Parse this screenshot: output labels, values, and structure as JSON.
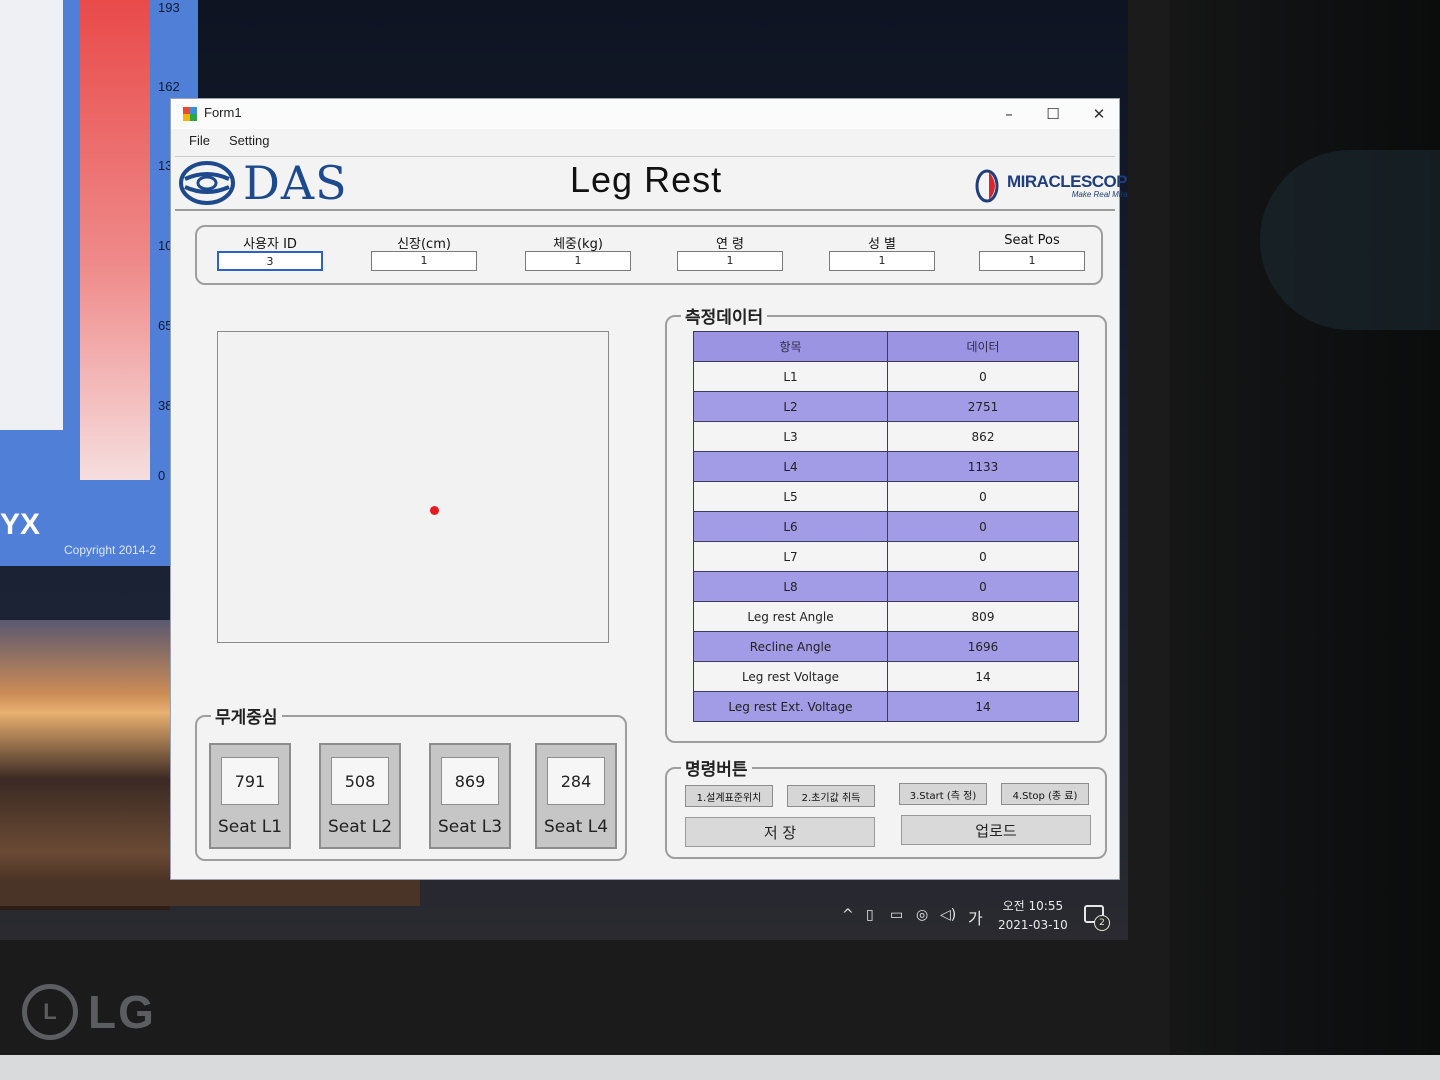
{
  "background_app": {
    "ticks": [
      "193",
      "162",
      "13",
      "10",
      "65",
      "38",
      "0"
    ],
    "brand": "YX",
    "copyright": "Copyright 2014-2"
  },
  "window": {
    "title": "Form1",
    "controls": {
      "minimize": "–",
      "maximize": "☐",
      "close": "✕"
    },
    "menu": [
      "File",
      "Setting"
    ]
  },
  "header": {
    "left_logo": "DAS",
    "title": "Leg Rest",
    "right_logo": "MIRACLESCOPE",
    "right_logo_tagline": "Make Real Miracle"
  },
  "user_info": [
    {
      "label": "사용자 ID",
      "value": "3",
      "active": true
    },
    {
      "label": "신장(cm)",
      "value": "1",
      "active": false
    },
    {
      "label": "체중(kg)",
      "value": "1",
      "active": false
    },
    {
      "label": "연  령",
      "value": "1",
      "active": false
    },
    {
      "label": "성  별",
      "value": "1",
      "active": false
    },
    {
      "label": "Seat Pos",
      "value": "1",
      "active": false
    }
  ],
  "center_of_gravity": {
    "dot_x_fraction": 0.55,
    "dot_y_fraction": 0.57
  },
  "measurement": {
    "title": "측정데이터",
    "headers": [
      "항목",
      "데이터"
    ],
    "rows": [
      {
        "item": "L1",
        "value": "0"
      },
      {
        "item": "L2",
        "value": "2751"
      },
      {
        "item": "L3",
        "value": "862"
      },
      {
        "item": "L4",
        "value": "1133"
      },
      {
        "item": "L5",
        "value": "0"
      },
      {
        "item": "L6",
        "value": "0"
      },
      {
        "item": "L7",
        "value": "0"
      },
      {
        "item": "L8",
        "value": "0"
      },
      {
        "item": "Leg rest Angle",
        "value": "809"
      },
      {
        "item": "Recline Angle",
        "value": "1696"
      },
      {
        "item": "Leg rest Voltage",
        "value": "14"
      },
      {
        "item": "Leg rest Ext. Voltage",
        "value": "14"
      }
    ]
  },
  "weight_center": {
    "title": "무게중심",
    "seats": [
      {
        "label": "Seat L1",
        "value": "791"
      },
      {
        "label": "Seat L2",
        "value": "508"
      },
      {
        "label": "Seat L3",
        "value": "869"
      },
      {
        "label": "Seat L4",
        "value": "284"
      }
    ]
  },
  "commands": {
    "title": "명령버튼",
    "buttons": [
      "1.설계표준위치",
      "2.초기값 취득",
      "3.Start (측 정)",
      "4.Stop (종 료)"
    ],
    "save": "저 장",
    "upload": "업로드"
  },
  "taskbar": {
    "ime": "가",
    "time": "오전 10:55",
    "date": "2021-03-10",
    "notifications": "2"
  },
  "monitor_brand": "LG",
  "colors": {
    "table_header": "#9a94e2",
    "table_row_alt": "#a29be6",
    "das_blue": "#1d4a8c",
    "dot_red": "#e21d1d"
  }
}
